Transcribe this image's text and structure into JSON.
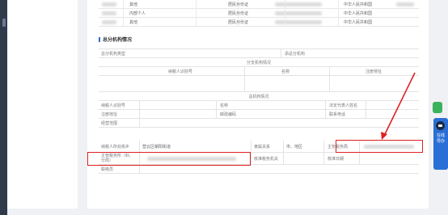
{
  "top_table": {
    "rows": [
      {
        "role": "其他",
        "id_type": "居民身份证",
        "nationality": "中华人民共和国"
      },
      {
        "role": "内部个人",
        "id_type": "居民身份证",
        "nationality": "中华人民共和国"
      },
      {
        "role": "其他",
        "id_type": "居民身份证",
        "nationality": "中华人民共和国"
      }
    ]
  },
  "section_title": "总分机构情况",
  "branch": {
    "type_label": "总分机构类型",
    "add_label": "添总分机构",
    "branch_header": "分支机构情况",
    "col_taxid": "纳税人识别号",
    "col_name": "名称",
    "col_address": "注册地址",
    "hq_header": "总机构情况"
  },
  "hq": {
    "taxid": "纳税人识别号",
    "name": "名称",
    "legal_rep": "法定代表人姓名",
    "reg_addr": "注册地址",
    "postcode": "邮政编码",
    "phone": "联系电话",
    "scope": "经营范围"
  },
  "tax_office": {
    "location_label": "纳税人所处街乡",
    "location_value": "营云区朝阳街道",
    "affiliation_label": "隶属关系",
    "affiliation_value": "市、地区",
    "authority_label": "主管税务局",
    "authority_sub_label": "主管税务所（科、分局）",
    "approval_label": "核准税务机关",
    "approval_date_label": "核准日期",
    "contact_label": "联络员"
  },
  "float": {
    "online_help": "在线导办"
  },
  "colors": {
    "highlight": "#e02020",
    "accent": "#2a6fd6",
    "green": "#3bb35c"
  }
}
